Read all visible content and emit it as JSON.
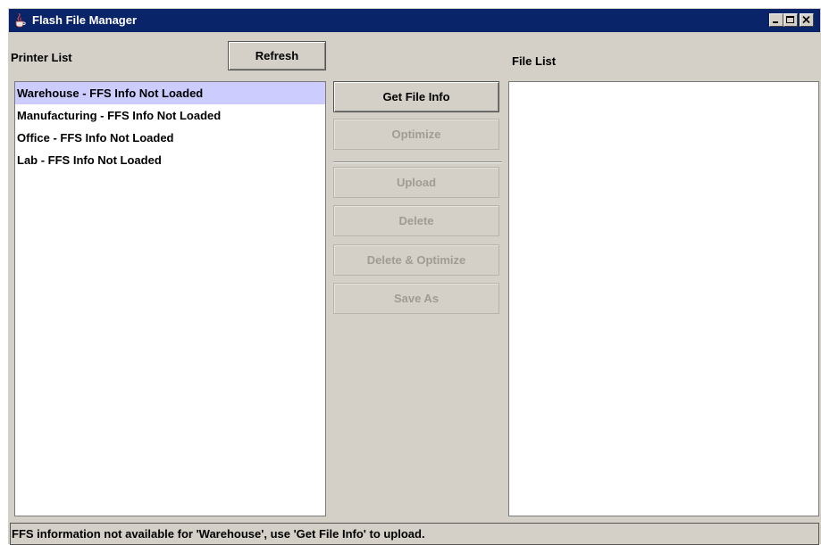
{
  "window": {
    "title": "Flash File Manager",
    "app_icon": "java-cup-icon",
    "controls": [
      "minimize-icon",
      "maximize-icon",
      "close-icon"
    ]
  },
  "printer_panel": {
    "label": "Printer List",
    "refresh_label": "Refresh",
    "items": [
      {
        "label": "Warehouse - FFS Info Not Loaded",
        "selected": true
      },
      {
        "label": "Manufacturing - FFS Info Not Loaded",
        "selected": false
      },
      {
        "label": "Office - FFS Info Not Loaded",
        "selected": false
      },
      {
        "label": "Lab - FFS Info Not Loaded",
        "selected": false
      }
    ]
  },
  "actions": {
    "get_file_info": {
      "label": "Get File Info",
      "enabled": true
    },
    "optimize": {
      "label": "Optimize",
      "enabled": false
    },
    "upload": {
      "label": "Upload",
      "enabled": false
    },
    "delete": {
      "label": "Delete",
      "enabled": false
    },
    "delete_optimize": {
      "label": "Delete & Optimize",
      "enabled": false
    },
    "save_as": {
      "label": "Save As",
      "enabled": false
    }
  },
  "file_panel": {
    "label": "File List",
    "items": []
  },
  "status": {
    "message": "FFS information not available for 'Warehouse', use 'Get File Info' to upload."
  },
  "colors": {
    "titlebar": "#0a246a",
    "window_bg": "#d4d0c8",
    "selection": "#ccccff",
    "disabled_text": "#a09c94"
  }
}
